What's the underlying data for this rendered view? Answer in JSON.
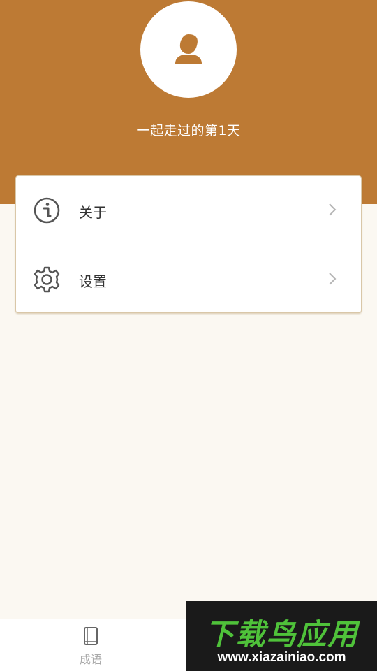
{
  "header": {
    "days_text": "一起走过的第1天",
    "avatar_icon": "user-avatar-icon"
  },
  "menu": {
    "items": [
      {
        "label": "关于",
        "icon": "info-icon"
      },
      {
        "label": "设置",
        "icon": "gear-icon"
      }
    ]
  },
  "tabbar": {
    "tabs": [
      {
        "label": "成语",
        "icon": "book-icon"
      }
    ]
  },
  "watermark": {
    "title": "下载鸟应用",
    "url": "www.xiazainiao.com"
  },
  "colors": {
    "header_bg": "#bd7a34",
    "page_bg": "#fbf8f2",
    "watermark_green": "#4fc23a"
  }
}
